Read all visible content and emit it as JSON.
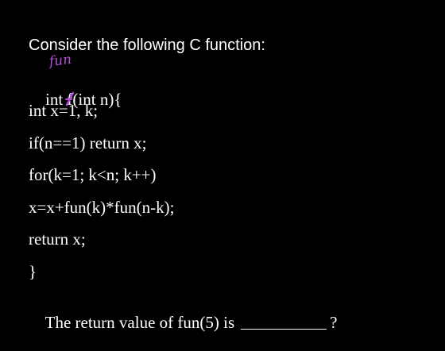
{
  "document": {
    "heading": "Consider the following C function:",
    "annotation": "fun",
    "code": {
      "signature_before": "int ",
      "signature_char": "f",
      "signature_after": "(int n){",
      "lines": [
        "int x=1, k;",
        "if(n==1) return x;",
        "for(k=1; k<n; k++)",
        "x=x+fun(k)*fun(n-k);",
        "return x;",
        "}"
      ]
    },
    "question_prefix": "The return value of fun(5) is",
    "question_suffix": "?"
  },
  "colors": {
    "background": "#000000",
    "text": "#ffffff",
    "annotation": "#b44ed6"
  }
}
